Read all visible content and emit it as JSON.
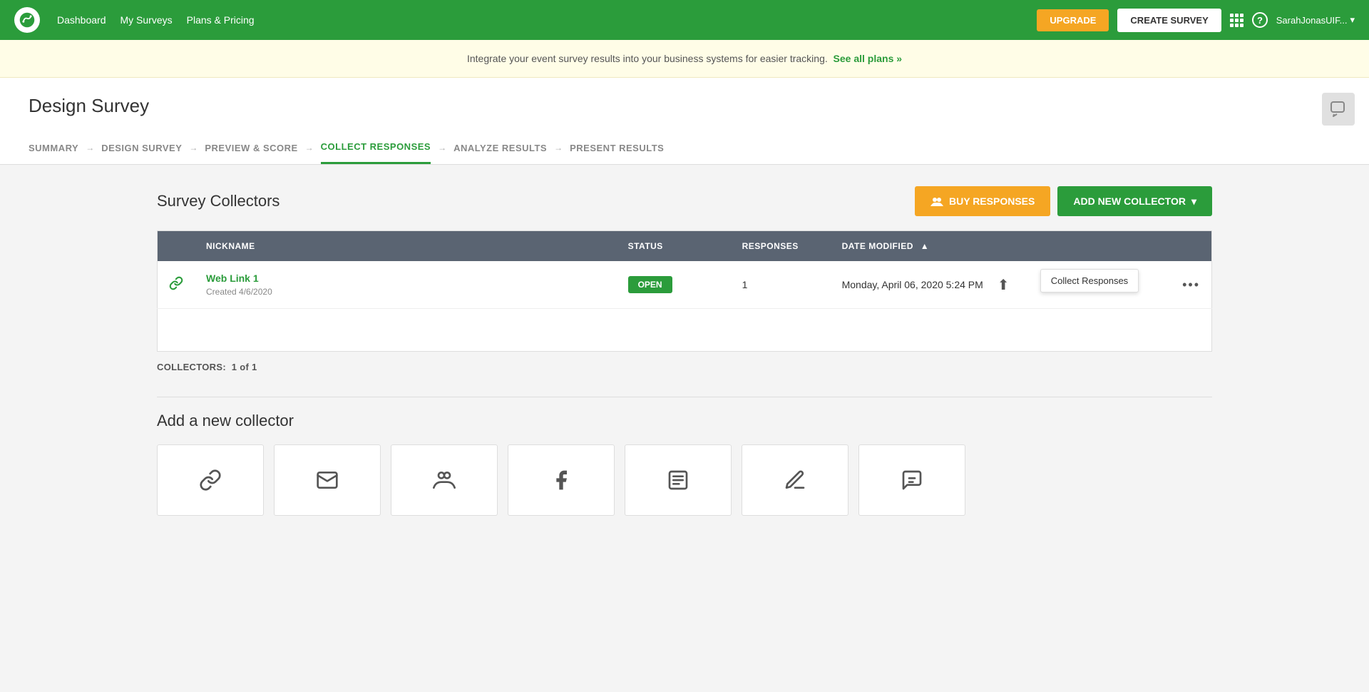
{
  "header": {
    "logo_alt": "SurveyMonkey",
    "nav": [
      {
        "label": "Dashboard",
        "name": "dashboard"
      },
      {
        "label": "My Surveys",
        "name": "my-surveys"
      },
      {
        "label": "Plans & Pricing",
        "name": "plans-pricing"
      }
    ],
    "upgrade_label": "UPGRADE",
    "create_survey_label": "CREATE SURVEY",
    "help_icon": "?",
    "user": "SarahJonasUIF...",
    "chevron": "▾"
  },
  "banner": {
    "text": "Integrate your event survey results into your business systems for easier tracking.",
    "link_text": "See all plans »"
  },
  "page": {
    "title": "Design Survey",
    "chat_icon": "💬"
  },
  "breadcrumbs": [
    {
      "label": "SUMMARY",
      "active": false
    },
    {
      "label": "DESIGN SURVEY",
      "active": false
    },
    {
      "label": "PREVIEW & SCORE",
      "active": false
    },
    {
      "label": "COLLECT RESPONSES",
      "active": true
    },
    {
      "label": "ANALYZE RESULTS",
      "active": false
    },
    {
      "label": "PRESENT RESULTS",
      "active": false
    }
  ],
  "collectors": {
    "title": "Survey Collectors",
    "buy_responses_label": "BUY RESPONSES",
    "add_collector_label": "ADD NEW COLLECTOR",
    "table_headers": {
      "nickname": "NICKNAME",
      "status": "STATUS",
      "responses": "RESPONSES",
      "date_modified": "DATE MODIFIED"
    },
    "rows": [
      {
        "name": "Web Link 1",
        "created": "Created 4/6/2020",
        "status": "OPEN",
        "responses": "1",
        "date_modified": "Monday, April 06, 2020 5:24 PM"
      }
    ],
    "count_label": "COLLECTORS:",
    "count_value": "1 of 1",
    "tooltip_text": "Collect Responses"
  },
  "add_collector": {
    "title": "Add a new collector",
    "cards": [
      {
        "icon": "🔗",
        "label": "web-link"
      },
      {
        "icon": "✉",
        "label": "email"
      },
      {
        "icon": "👥",
        "label": "contacts"
      },
      {
        "icon": "f",
        "label": "facebook"
      },
      {
        "icon": "📋",
        "label": "survey"
      },
      {
        "icon": "✏",
        "label": "edit"
      },
      {
        "icon": "💬",
        "label": "messenger"
      }
    ]
  }
}
